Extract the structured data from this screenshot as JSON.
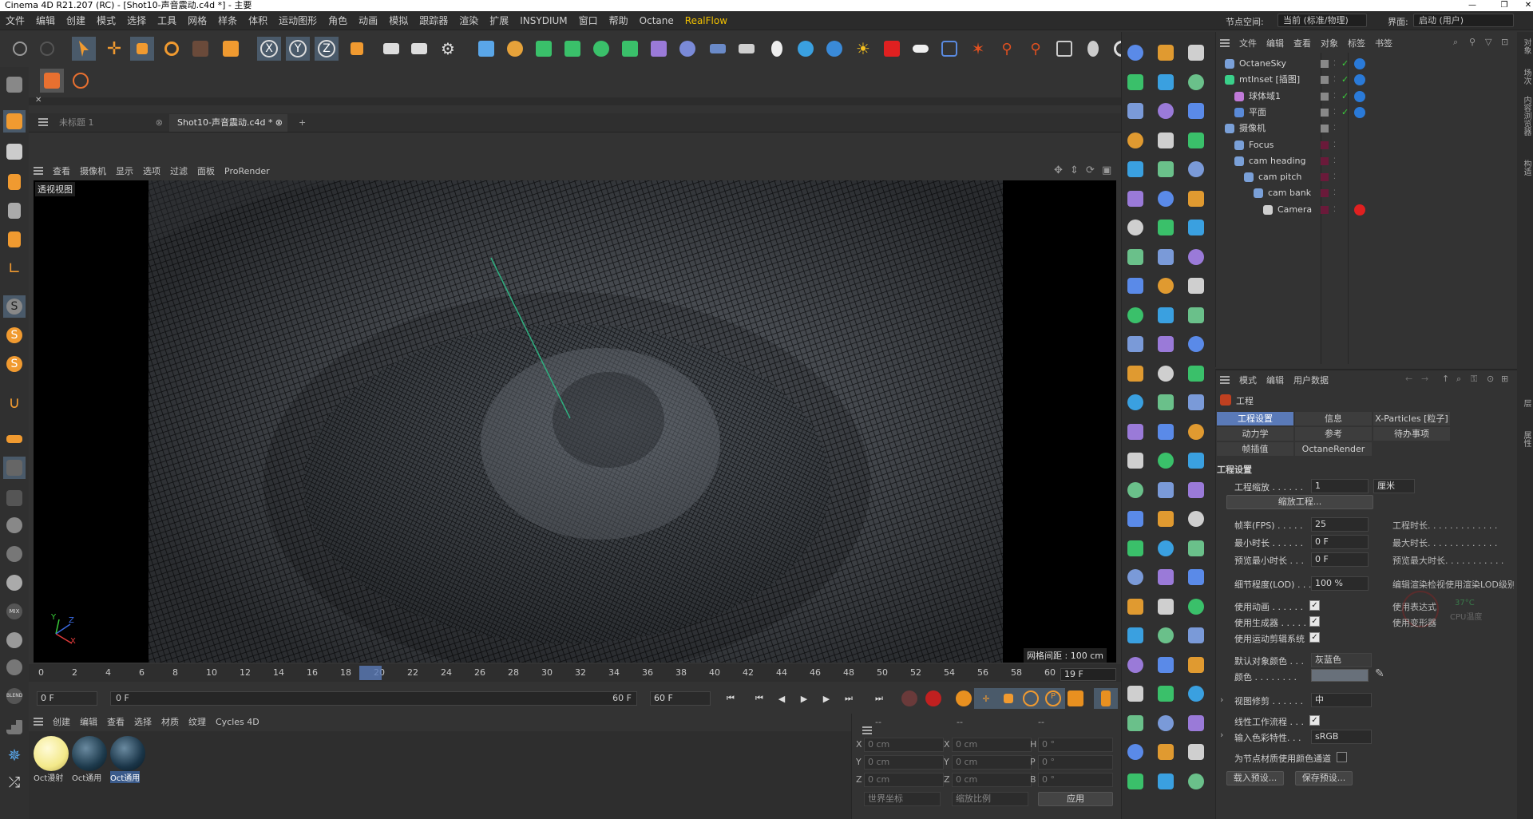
{
  "window": {
    "title": "Cinema 4D R21.207 (RC) - [Shot10-声音震动.c4d *] - 主要",
    "min_icon": "minimize-icon",
    "max_icon": "restore-icon",
    "close_icon": "close-icon"
  },
  "menubar": {
    "items": [
      "文件",
      "编辑",
      "创建",
      "模式",
      "选择",
      "工具",
      "网格",
      "样条",
      "体积",
      "运动图形",
      "角色",
      "动画",
      "模拟",
      "跟踪器",
      "渲染",
      "扩展",
      "INSYDIUM",
      "窗口",
      "帮助",
      "Octane",
      "RealFlow"
    ],
    "node_space_label": "节点空间:",
    "node_space_value": "当前 (标准/物理)",
    "layout_label": "界面:",
    "layout_value": "启动 (用户)"
  },
  "tabs": {
    "items": [
      {
        "label": "未标题 1",
        "active": false
      },
      {
        "label": "Shot10-声音震动.c4d *",
        "active": true
      }
    ],
    "add_label": "+"
  },
  "viewport": {
    "menu": [
      "查看",
      "摄像机",
      "显示",
      "选项",
      "过滤",
      "面板",
      "ProRender"
    ],
    "view_name": "透视视图",
    "grid_info": "网格间距 : 100 cm",
    "axis_x": "X",
    "axis_y": "Y",
    "axis_z": "Z"
  },
  "timeline": {
    "ticks": [
      "0",
      "2",
      "4",
      "6",
      "8",
      "10",
      "12",
      "14",
      "16",
      "18",
      "20",
      "22",
      "24",
      "26",
      "28",
      "30",
      "32",
      "34",
      "36",
      "38",
      "40",
      "42",
      "44",
      "46",
      "48",
      "50",
      "52",
      "54",
      "56",
      "58",
      "60"
    ],
    "current_frame": "19",
    "current_frame_display": "19 F",
    "start_field": "0 F",
    "range_start": "0 F",
    "range_end": "60 F",
    "end_field": "60 F"
  },
  "material_manager": {
    "menu": [
      "创建",
      "编辑",
      "查看",
      "选择",
      "材质",
      "纹理",
      "Cycles 4D"
    ],
    "materials": [
      {
        "name": "Oct漫射",
        "color": "#f3e98a"
      },
      {
        "name": "Oct通用",
        "color": "#1d3a4c"
      },
      {
        "name": "Oct通用",
        "color": "#1a3548"
      }
    ]
  },
  "coordinates": {
    "headers": [
      "--",
      "--",
      "--"
    ],
    "rows": [
      {
        "a": "X",
        "av": "0 cm",
        "b": "X",
        "bv": "0 cm",
        "c": "H",
        "cv": "0 °"
      },
      {
        "a": "Y",
        "av": "0 cm",
        "b": "Y",
        "bv": "0 cm",
        "c": "P",
        "cv": "0 °"
      },
      {
        "a": "Z",
        "av": "0 cm",
        "b": "Z",
        "bv": "0 cm",
        "c": "B",
        "cv": "0 °"
      }
    ],
    "world_select": "世界坐标",
    "scale_select": "缩放比例",
    "apply_label": "应用"
  },
  "object_manager": {
    "menu": [
      "文件",
      "编辑",
      "查看",
      "对象",
      "标签",
      "书签"
    ],
    "objects": [
      {
        "name": "OctaneSky",
        "indent": 0
      },
      {
        "name": "mtInset [插图]",
        "indent": 0
      },
      {
        "name": "球体域1",
        "indent": 1
      },
      {
        "name": "平面",
        "indent": 1
      },
      {
        "name": "摄像机",
        "indent": 0
      },
      {
        "name": "Focus",
        "indent": 1
      },
      {
        "name": "cam heading",
        "indent": 1
      },
      {
        "name": "cam pitch",
        "indent": 2
      },
      {
        "name": "cam bank",
        "indent": 3
      },
      {
        "name": "Camera",
        "indent": 4
      }
    ]
  },
  "attributes": {
    "menu": [
      "模式",
      "编辑",
      "用户数据"
    ],
    "title": "工程",
    "tabs_row1": [
      "工程设置",
      "信息",
      "X-Particles [粒子]"
    ],
    "tabs_row2": [
      "动力学",
      "参考",
      "待办事项"
    ],
    "tabs_row3": [
      "帧插值",
      "OctaneRender"
    ],
    "section": "工程设置",
    "scale_label": "工程缩放 . . . . . .",
    "scale_value": "1",
    "scale_unit": "厘米",
    "scale_button": "缩放工程...",
    "fps_label": "帧率(FPS) . . . . .",
    "fps_value": "25",
    "min_time_label": "最小时长 . . . . . .",
    "min_time_value": "0 F",
    "preview_min_label": "预览最小时长 . . .",
    "preview_min_value": "0 F",
    "lod_label": "细节程度(LOD) . . .",
    "lod_value": "100 %",
    "proj_time_label": "工程时长. . . . . . . . . . . . .",
    "max_time_label": "最大时长. . . . . . . . . . . . .",
    "preview_max_label": "预览最大时长. . . . . . . . . . .",
    "lod_render_label": "编辑渲染检视使用渲染LOD级别",
    "use_anim": "使用动画 . . . . . .",
    "use_gen": "使用生成器 . . . . .",
    "use_motion": "使用运动剪辑系统",
    "use_expr": "使用表达式",
    "use_deform": "使用变形器",
    "cpu_temp": "37°C",
    "cpu_label": "CPU温度",
    "default_color_label": "默认对象颜色 . . .",
    "default_color_value": "灰蓝色",
    "color_label": "颜色 . . . . . . . .",
    "view_clip_label": "视图修剪 . . . . . .",
    "view_clip_value": "中",
    "linear_label": "线性工作流程 . . .",
    "input_color_label": "输入色彩特性. . .",
    "input_color_value": "sRGB",
    "node_color_label": "为节点材质使用颜色通道",
    "load_preset": "载入预设...",
    "save_preset": "保存预设..."
  },
  "side_tabs": [
    "对象",
    "场次",
    "内容浏览器",
    "构造",
    "层",
    "属性"
  ]
}
